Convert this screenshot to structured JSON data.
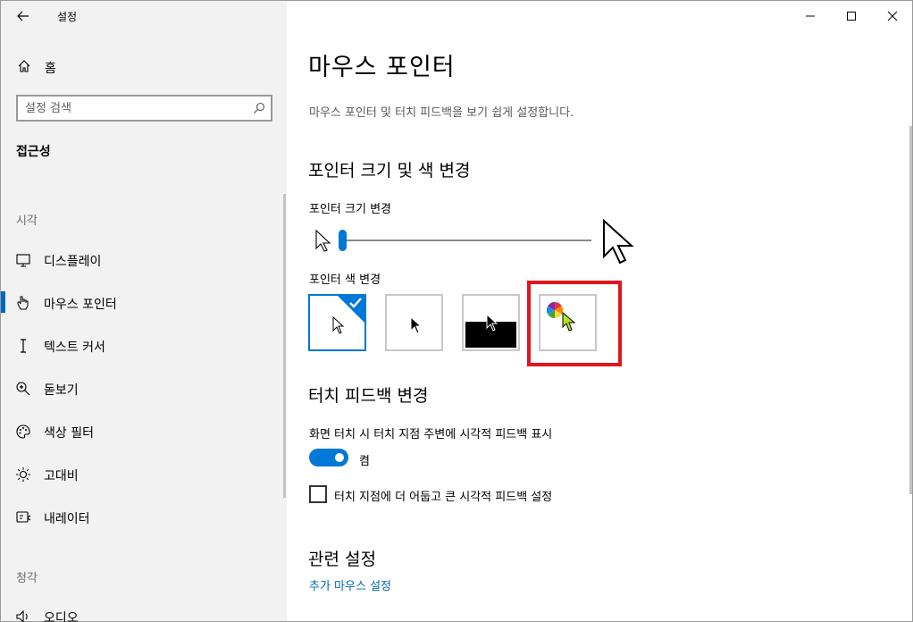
{
  "window": {
    "app_title": "설정",
    "controls": [
      "minimize",
      "maximize",
      "close"
    ]
  },
  "sidebar": {
    "home_label": "홈",
    "search_placeholder": "설정 검색",
    "section_title": "접근성",
    "groups": [
      {
        "heading": "시각",
        "items": [
          {
            "label": "디스플레이",
            "icon": "monitor-icon",
            "active": false
          },
          {
            "label": "마우스 포인터",
            "icon": "pointer-hand-icon",
            "active": true
          },
          {
            "label": "텍스트 커서",
            "icon": "text-cursor-icon",
            "active": false
          },
          {
            "label": "돋보기",
            "icon": "magnifier-icon",
            "active": false
          },
          {
            "label": "색상 필터",
            "icon": "palette-icon",
            "active": false
          },
          {
            "label": "고대비",
            "icon": "high-contrast-icon",
            "active": false
          },
          {
            "label": "내레이터",
            "icon": "narrator-icon",
            "active": false
          }
        ]
      },
      {
        "heading": "청각",
        "items": [
          {
            "label": "오디오",
            "icon": "speaker-icon",
            "active": false
          }
        ]
      }
    ]
  },
  "main": {
    "title": "마우스 포인터",
    "description": "마우스 포인터 및 터치 피드백을 보기 쉽게 설정합니다.",
    "pointer_section": {
      "heading": "포인터 크기 및 색 변경",
      "size_label": "포인터 크기 변경",
      "size_value": 1,
      "color_label": "포인터 색 변경",
      "color_options": [
        {
          "id": "white",
          "selected": true
        },
        {
          "id": "black",
          "selected": false
        },
        {
          "id": "inverted",
          "selected": false
        },
        {
          "id": "custom",
          "selected": false
        }
      ]
    },
    "touch_section": {
      "heading": "터치 피드백 변경",
      "toggle_label": "화면 터치 시 터치 지점 주변에 시각적 피드백 표시",
      "toggle_state": "켬",
      "toggle_on": true,
      "checkbox_label": "터치 지점에 더 어둡고 큰 시각적 피드백 설정",
      "checkbox_checked": false
    },
    "related": {
      "heading": "관련 설정",
      "link": "추가 마우스 설정"
    }
  },
  "colors": {
    "accent": "#0078d7",
    "highlight": "#e0161d",
    "link": "#0067b8"
  }
}
